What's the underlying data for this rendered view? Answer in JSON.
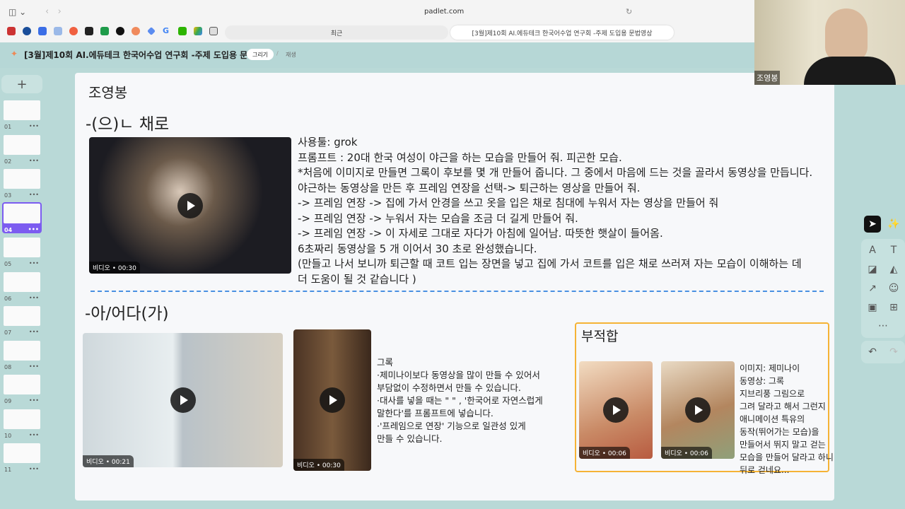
{
  "browser": {
    "url": "padlet.com",
    "tabs": [
      "최근",
      "[3월]제10회 AI.에듀테크 한국어수업 연구회 -주제 도입용 문법영상"
    ]
  },
  "header": {
    "title": "[3월]제10회 AI.에듀테크 한국어수업 연구회 -주제 도입용 문법영상",
    "draw_button": "그리기",
    "sub": "재생"
  },
  "sidebar": {
    "add": "+",
    "slides": [
      "01",
      "02",
      "03",
      "04",
      "05",
      "06",
      "07",
      "08",
      "09",
      "10",
      "11"
    ],
    "active": "04",
    "more": "•••"
  },
  "slide": {
    "author": "조영봉",
    "section1": {
      "title": "-(으)ㄴ 채로",
      "video_caption": "비디오 • 00:30",
      "text": "사용툴: grok\n프롬프트 : 20대 한국 여성이 야근을 하는 모습을 만들어 줘. 피곤한 모습.\n*처음에 이미지로 만들면 그록이 후보를 몇 개 만들어 줍니다. 그 중에서 마음에 드는 것을 골라서 동영상을 만듭니다.\n야근하는 동영상을 만든 후 프레임 연장을 선택-> 퇴근하는 영상을 만들어 줘.\n-> 프레임 연장 -> 집에 가서 안경을 쓰고 옷을 입은 채로 침대에 누워서 자는 영상을 만들어 줘\n-> 프레임 연장 -> 누워서 자는 모습을 조금 더 길게 만들어 줘.\n-> 프레임 연장 -> 이 자세로 그대로 자다가 아침에 일어남. 따뜻한 햇살이 들어옴.\n6초짜리 동영상을 5 개 이어서 30 초로 완성했습니다.\n(만들고 나서 보니까 퇴근할 때 코트 입는 장면을 넣고 집에 가서 코트를 입은 채로 쓰러져 자는 모습이 이해하는 데\n더 도움이 될 것 같습니다 )"
    },
    "section2": {
      "title": "-아/어다(가)",
      "video1_caption": "비디오 • 00:21",
      "video2_caption": "비디오 • 00:30",
      "text": "그록\n·제미나이보다 동영상을 많이 만들 수 있어서\n부담없이 수정하면서 만들 수 있습니다.\n·대사를 넣을 때는 \" \" , '한국어로 자연스럽게\n말한다'를 프롬프트에 넣습니다.\n·'프레임으로 연장' 기능으로 일관성 있게\n만들 수 있습니다."
    },
    "unsuitable": {
      "title": "부적합",
      "video1_caption": "비디오 • 00:06",
      "video2_caption": "비디오 • 00:06",
      "text": "이미지: 제미나이\n동영상: 그록\n지브리풍 그림으로\n그려 달라고 해서 그런지\n애니메이션 특유의\n동작(뛰어가는 모습)을\n만들어서 뛰지 말고 걷는\n모습을 만들어 달라고 하니\n뒤로 걷네요..."
    }
  },
  "webcam": {
    "name": "조영봉"
  },
  "colors": {
    "accent": "#7c5cf0",
    "border": "#f5b335",
    "divider": "#4a90e2"
  }
}
